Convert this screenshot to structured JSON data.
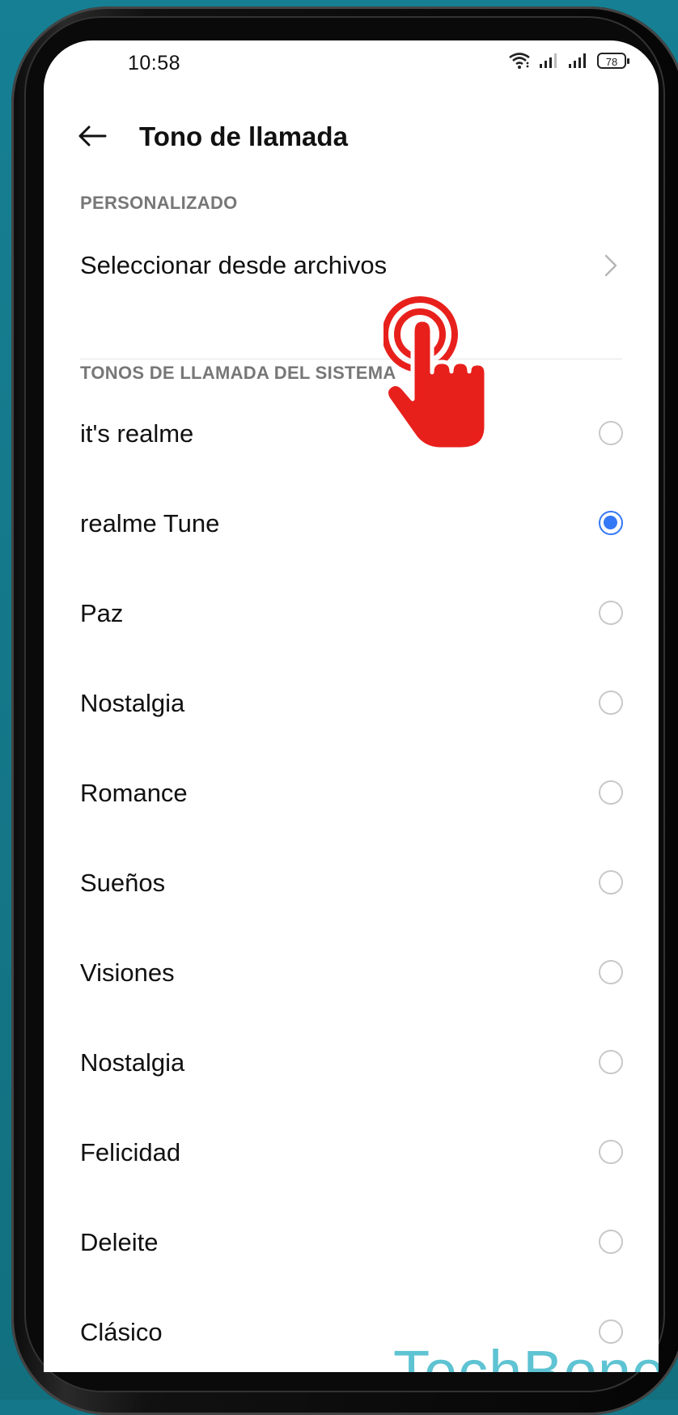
{
  "status_bar": {
    "time": "10:58",
    "battery": "78"
  },
  "header": {
    "title": "Tono de llamada"
  },
  "custom_section": {
    "label": "PERSONALIZADO",
    "select_from_files": "Seleccionar desde archivos"
  },
  "system_section": {
    "label": "TONOS DE LLAMADA DEL SISTEMA"
  },
  "tones": [
    {
      "name": "it's realme",
      "selected": false
    },
    {
      "name": "realme Tune",
      "selected": true
    },
    {
      "name": "Paz",
      "selected": false
    },
    {
      "name": "Nostalgia",
      "selected": false
    },
    {
      "name": "Romance",
      "selected": false
    },
    {
      "name": "Sueños",
      "selected": false
    },
    {
      "name": "Visiones",
      "selected": false
    },
    {
      "name": "Nostalgia",
      "selected": false
    },
    {
      "name": "Felicidad",
      "selected": false
    },
    {
      "name": "Deleite",
      "selected": false
    },
    {
      "name": "Clásico",
      "selected": false
    }
  ],
  "watermark": "TechBone",
  "colors": {
    "background": "#14778a",
    "accent": "#3478f6",
    "hand": "#e8201c",
    "watermark": "#5ec3d2"
  }
}
